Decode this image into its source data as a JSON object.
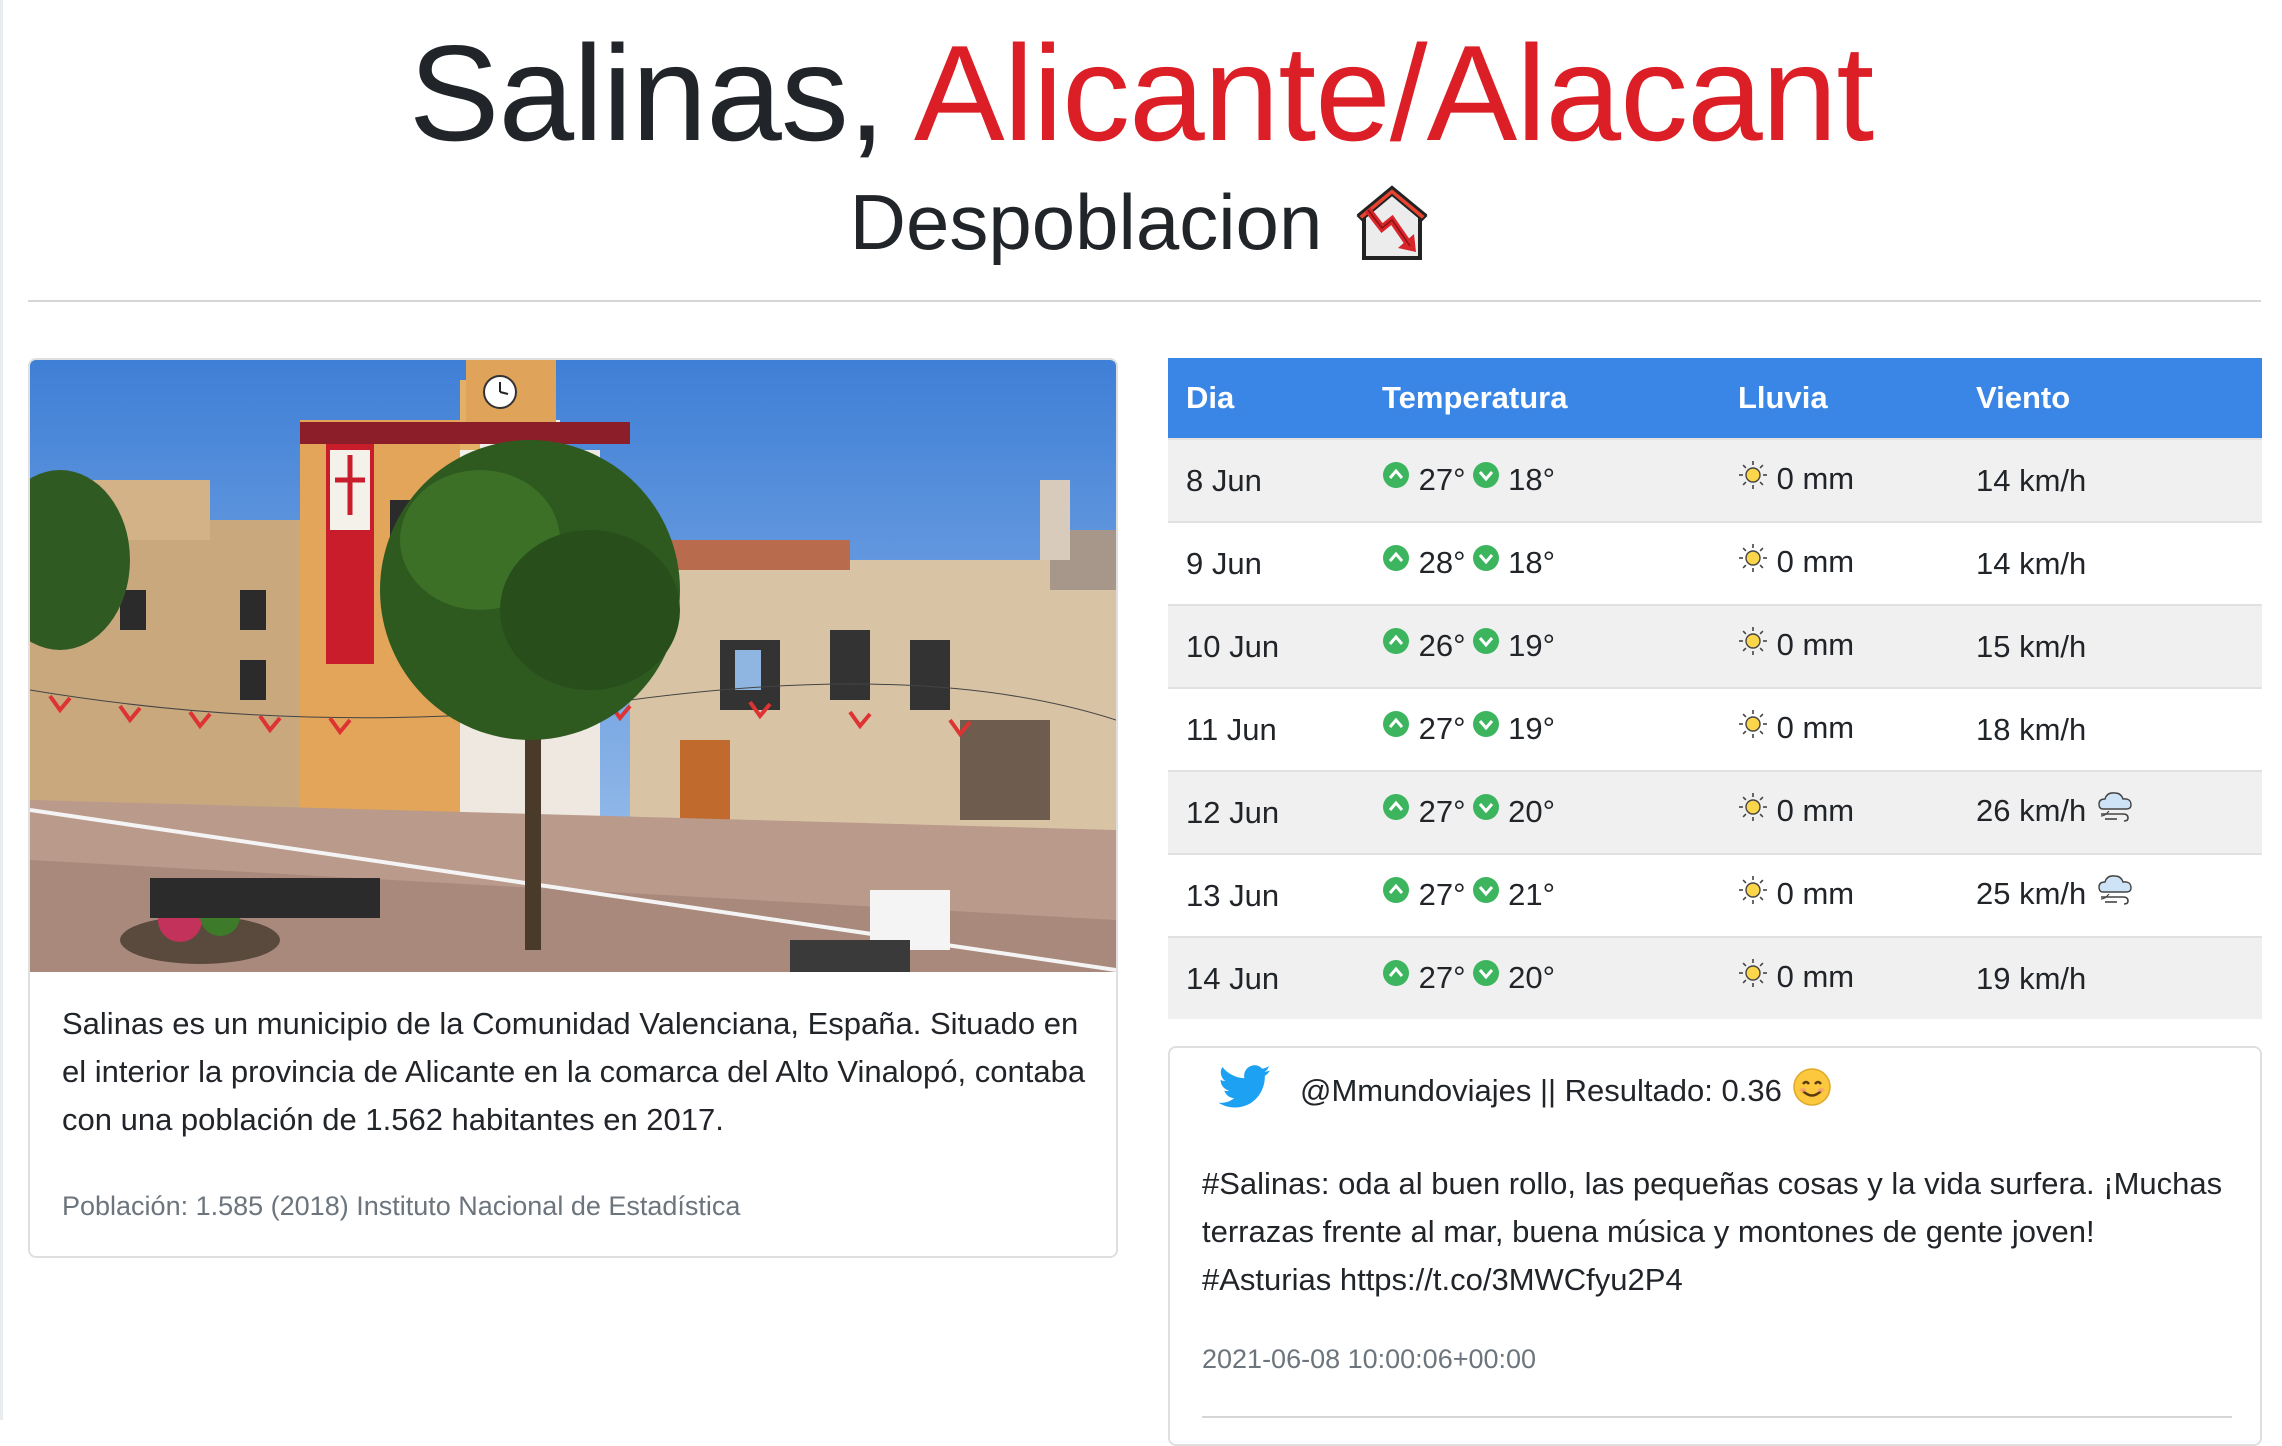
{
  "header": {
    "city": "Salinas,",
    "province": "Alicante/Alacant",
    "subtitle": "Despoblacion",
    "subtitle_icon": "depopulation-house-chart-icon"
  },
  "colors": {
    "accent_red": "#dc1f26",
    "table_header": "#3a86e6",
    "up_green": "#3cb55e",
    "twitter_blue": "#1da1f2"
  },
  "card": {
    "image_alt": "town-square-photo",
    "text": "Salinas es un municipio de la Comunidad Valenciana, España. Situado en el interior la provincia de Alicante en la comarca del Alto Vinalopó, contaba con una población de 1.562 habitantes en 2017.",
    "footer": "Población: 1.585 (2018) Instituto Nacional de Estadística"
  },
  "weather": {
    "headers": [
      "Dia",
      "Temperatura",
      "Lluvia",
      "Viento"
    ],
    "rows": [
      {
        "day": "8 Jun",
        "max": "27°",
        "min": "18°",
        "rain": "0 mm",
        "wind": "14 km/h",
        "wind_icon": ""
      },
      {
        "day": "9 Jun",
        "max": "28°",
        "min": "18°",
        "rain": "0 mm",
        "wind": "14 km/h",
        "wind_icon": ""
      },
      {
        "day": "10 Jun",
        "max": "26°",
        "min": "19°",
        "rain": "0 mm",
        "wind": "15 km/h",
        "wind_icon": ""
      },
      {
        "day": "11 Jun",
        "max": "27°",
        "min": "19°",
        "rain": "0 mm",
        "wind": "18 km/h",
        "wind_icon": ""
      },
      {
        "day": "12 Jun",
        "max": "27°",
        "min": "20°",
        "rain": "0 mm",
        "wind": "26 km/h",
        "wind_icon": "windy-cloud-icon"
      },
      {
        "day": "13 Jun",
        "max": "27°",
        "min": "21°",
        "rain": "0 mm",
        "wind": "25 km/h",
        "wind_icon": "windy-cloud-icon"
      },
      {
        "day": "14 Jun",
        "max": "27°",
        "min": "20°",
        "rain": "0 mm",
        "wind": "19 km/h",
        "wind_icon": ""
      }
    ]
  },
  "tweet": {
    "user_line": "@Mmundoviajes || Resultado: 0.36",
    "sentiment_icon": "smiling-face-icon",
    "text": "#Salinas: oda al buen rollo, las pequeñas cosas y la vida surfera. ¡Muchas terrazas frente al mar, buena música y montones de gente joven! #Asturias https://t.co/3MWCfyu2P4",
    "date": "2021-06-08 10:00:06+00:00"
  }
}
